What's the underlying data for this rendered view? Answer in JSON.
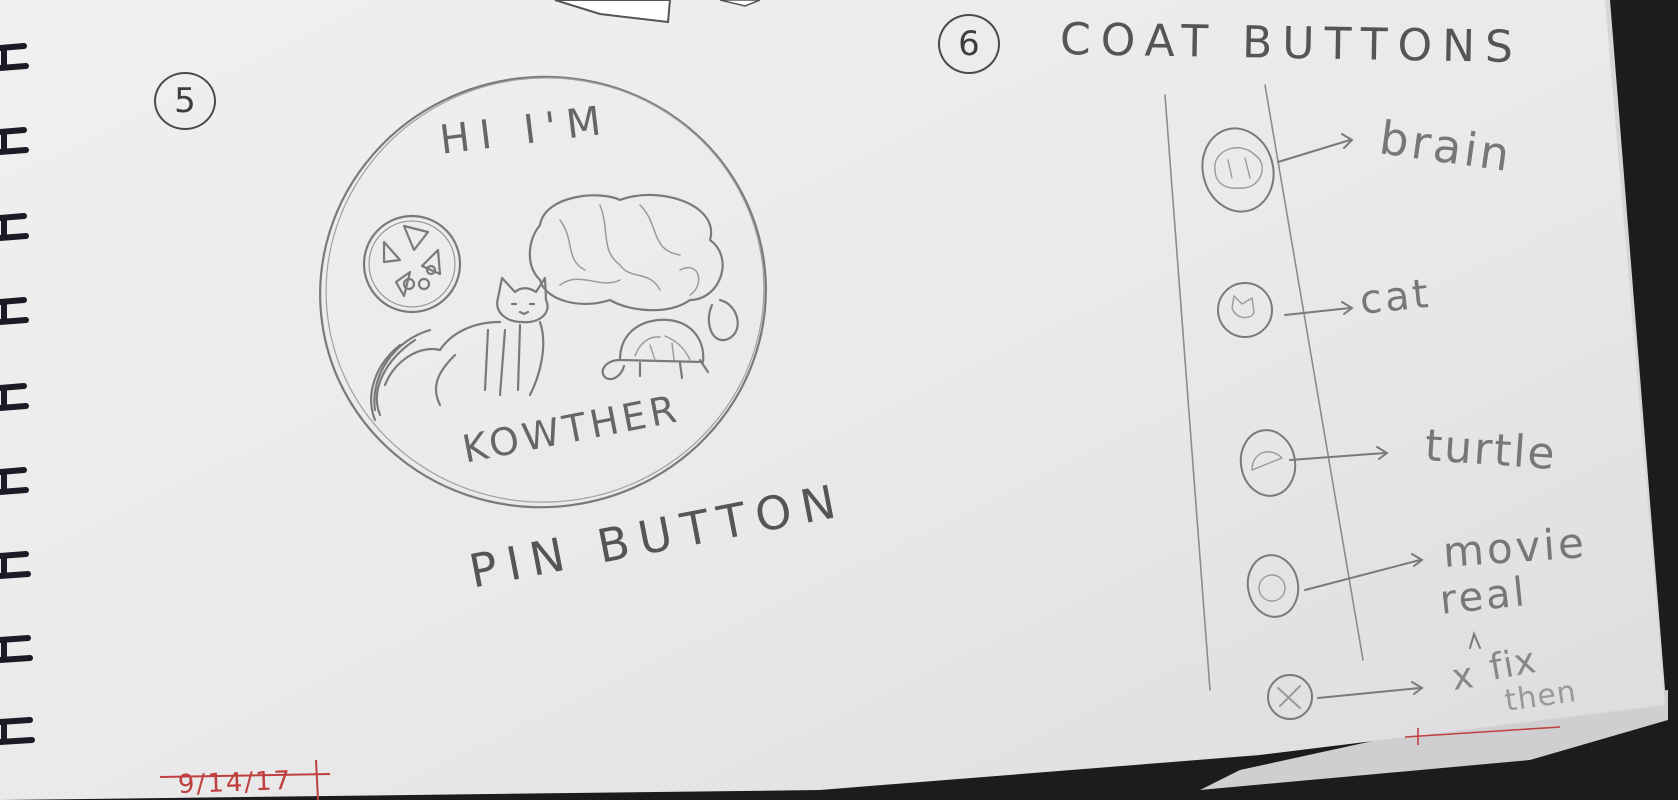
{
  "colors": {
    "paper": "#ebebeb",
    "pencil": "#7d7d7d",
    "pencil_dark": "#3e3e3e",
    "background": "#1c1c1e",
    "binding": "#1b1b26",
    "red_ink": "#c04040"
  },
  "sketch_5": {
    "number": "5",
    "badge_top_text": "HI I'M",
    "badge_bottom_text": "KOWTHER",
    "caption": "PIN BUTTON",
    "drawings": [
      "brain-icon",
      "cat-icon",
      "turtle-icon",
      "movie-reel-icon"
    ]
  },
  "sketch_6": {
    "number": "6",
    "title": "COAT BUTTONS",
    "items": [
      {
        "label": "brain",
        "icon": "brain-icon"
      },
      {
        "label": "cat",
        "icon": "cat-icon"
      },
      {
        "label": "turtle",
        "icon": "turtle-icon"
      },
      {
        "label": "movie",
        "label2": "real",
        "icon": "movie-reel-icon"
      },
      {
        "label": "x",
        "label2": "fix",
        "label3": "then",
        "icon": "x-icon"
      }
    ]
  },
  "date_note": "9/14/17"
}
